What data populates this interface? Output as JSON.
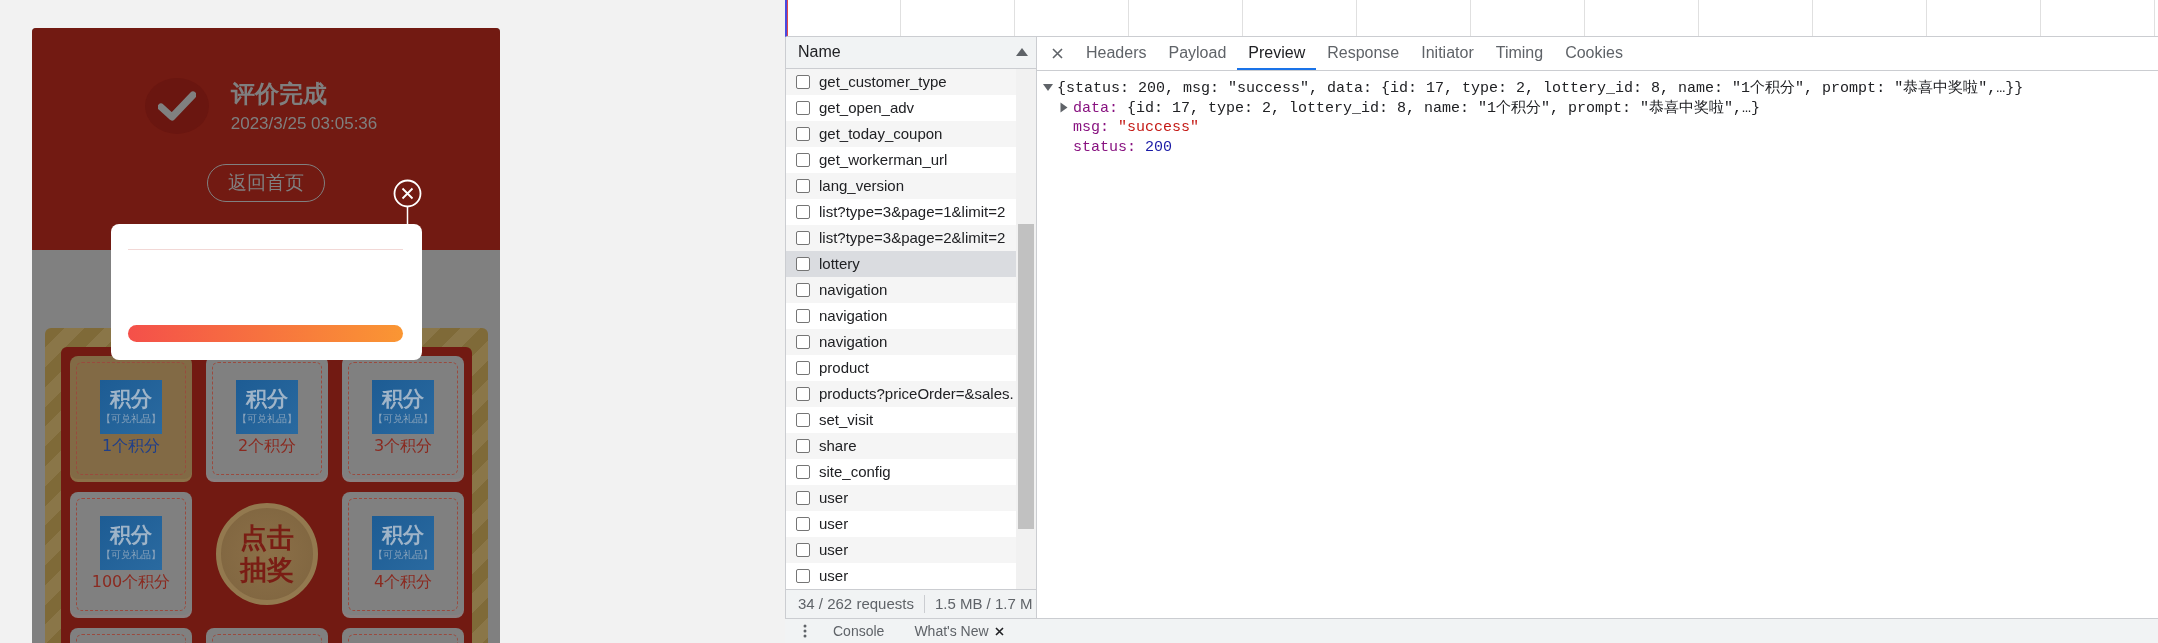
{
  "phone": {
    "title": "评价完成",
    "time": "2023/3/25 03:05:36",
    "home_button": "返回首页",
    "prizes": [
      {
        "badge_title": "积分",
        "badge_subtitle": "【可兑礼品】",
        "label": "1个积分",
        "selected": true
      },
      {
        "badge_title": "积分",
        "badge_subtitle": "【可兑礼品】",
        "label": "2个积分",
        "selected": false
      },
      {
        "badge_title": "积分",
        "badge_subtitle": "【可兑礼品】",
        "label": "3个积分",
        "selected": false
      },
      {
        "badge_title": "积分",
        "badge_subtitle": "【可兑礼品】",
        "label": "100个积分",
        "selected": false
      },
      {
        "badge_title": "积分",
        "badge_subtitle": "【可兑礼品】",
        "label": "4个积分",
        "selected": false
      },
      {
        "selected": false
      },
      {
        "selected": false
      },
      {
        "selected": false
      }
    ],
    "draw_button": [
      "点击",
      "抽奖"
    ]
  },
  "network": {
    "column": "Name",
    "requests": [
      {
        "name": "get_customer_type",
        "selected": false
      },
      {
        "name": "get_open_adv",
        "selected": false
      },
      {
        "name": "get_today_coupon",
        "selected": false
      },
      {
        "name": "get_workerman_url",
        "selected": false
      },
      {
        "name": "lang_version",
        "selected": false
      },
      {
        "name": "list?type=3&page=1&limit=2",
        "selected": false
      },
      {
        "name": "list?type=3&page=2&limit=2",
        "selected": false
      },
      {
        "name": "lottery",
        "selected": true
      },
      {
        "name": "navigation",
        "selected": false
      },
      {
        "name": "navigation",
        "selected": false
      },
      {
        "name": "navigation",
        "selected": false
      },
      {
        "name": "product",
        "selected": false
      },
      {
        "name": "products?priceOrder=&sales.",
        "selected": false
      },
      {
        "name": "set_visit",
        "selected": false
      },
      {
        "name": "share",
        "selected": false
      },
      {
        "name": "site_config",
        "selected": false
      },
      {
        "name": "user",
        "selected": false
      },
      {
        "name": "user",
        "selected": false
      },
      {
        "name": "user",
        "selected": false
      },
      {
        "name": "user",
        "selected": false
      }
    ],
    "status_bar": {
      "requests": "34 / 262 requests",
      "transferred": "1.5 MB / 1.7 M"
    }
  },
  "details": {
    "tabs": [
      {
        "label": "Headers",
        "selected": false
      },
      {
        "label": "Payload",
        "selected": false
      },
      {
        "label": "Preview",
        "selected": true
      },
      {
        "label": "Response",
        "selected": false
      },
      {
        "label": "Initiator",
        "selected": false
      },
      {
        "label": "Timing",
        "selected": false
      },
      {
        "label": "Cookies",
        "selected": false
      }
    ],
    "preview": {
      "summary": "{status: 200, msg: \"success\", data: {id: 17, type: 2, lottery_id: 8, name: \"1个积分\", prompt: \"恭喜中奖啦\",…}}",
      "expanded": true,
      "children": [
        {
          "key": "data:",
          "kind": "object",
          "value": "{id: 17, type: 2, lottery_id: 8, name: \"1个积分\", prompt: \"恭喜中奖啦\",…}",
          "expanded": false
        },
        {
          "key": "msg:",
          "kind": "string",
          "value": "\"success\""
        },
        {
          "key": "status:",
          "kind": "number",
          "value": "200"
        }
      ]
    }
  },
  "drawer": {
    "tabs": [
      "Console",
      "What's New"
    ]
  }
}
